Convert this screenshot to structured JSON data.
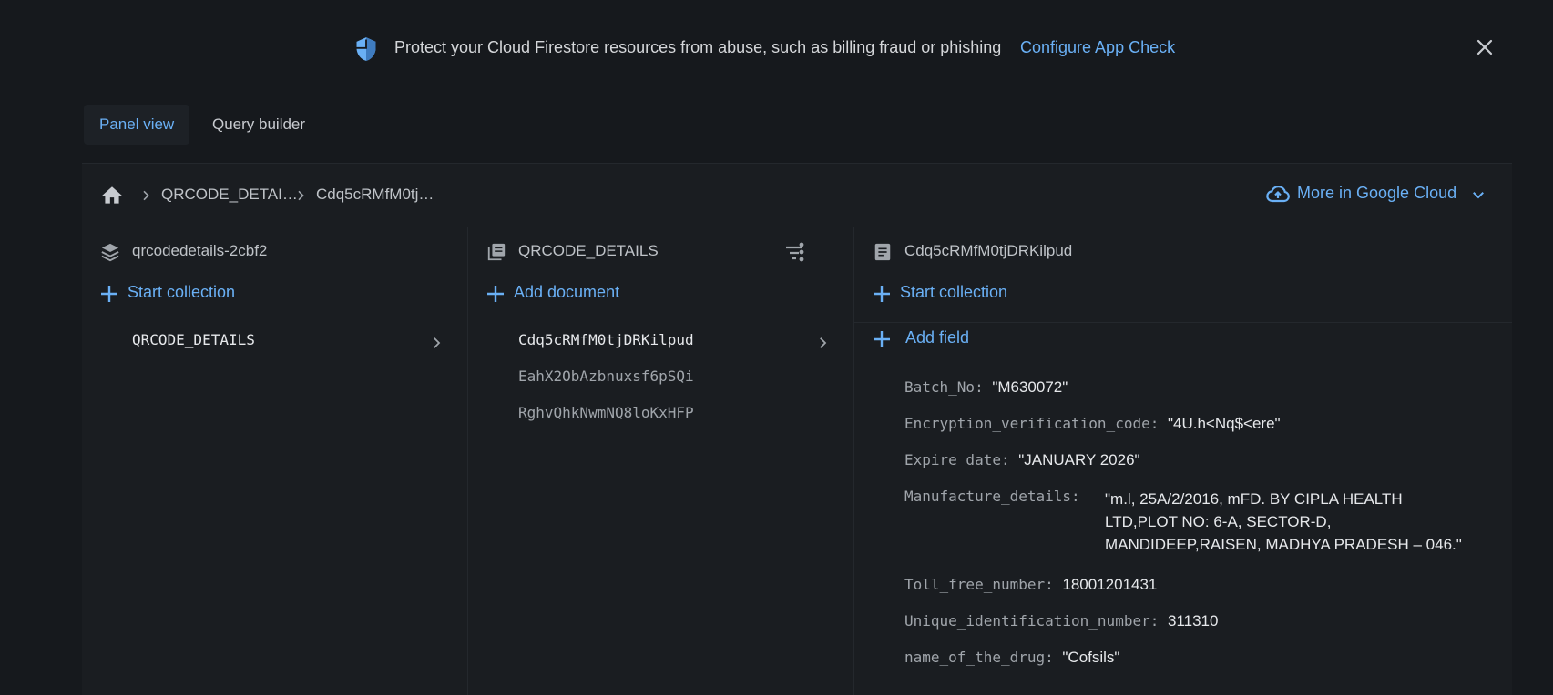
{
  "banner": {
    "icon": "shield-icon",
    "message": "Protect your Cloud Firestore resources from abuse, such as billing fraud or phishing",
    "link": "Configure App Check",
    "close_icon": "close-icon"
  },
  "tabs": [
    {
      "label": "Panel view",
      "active": true
    },
    {
      "label": "Query builder",
      "active": false
    }
  ],
  "breadcrumb": {
    "home_icon": "home-icon",
    "items": [
      "QRCODE_DETAI…",
      "Cdq5cRMfM0tj…"
    ],
    "more_label": "More in Google Cloud"
  },
  "columns": {
    "root": {
      "title": "qrcodedetails-2cbf2",
      "action": "Start collection",
      "items": [
        {
          "label": "QRCODE_DETAILS",
          "selected": true
        }
      ]
    },
    "collection": {
      "title": "QRCODE_DETAILS",
      "action": "Add document",
      "items": [
        {
          "label": "Cdq5cRMfM0tjDRKilpud",
          "selected": true
        },
        {
          "label": "EahX2ObAzbnuxsf6pSQi",
          "selected": false
        },
        {
          "label": "RghvQhkNwmNQ8loKxHFP",
          "selected": false
        }
      ]
    },
    "document": {
      "title": "Cdq5cRMfM0tjDRKilpud",
      "action": "Start collection",
      "add_field": "Add field",
      "fields": [
        {
          "key": "Batch_No:",
          "value": "\"M630072\""
        },
        {
          "key": "Encryption_verification_code:",
          "value": "\"4U.h<Nq$<ere\""
        },
        {
          "key": "Expire_date:",
          "value": "\"JANUARY 2026\""
        },
        {
          "key": "Manufacture_details:",
          "value": "\"m.l, 25A/2/2016, mFD. BY CIPLA HEALTH LTD,PLOT NO: 6-A, SECTOR-D, MANDIDEEP,RAISEN, MADHYA PRADESH – 046.\""
        },
        {
          "key": "Toll_free_number:",
          "value": "18001201431"
        },
        {
          "key": "Unique_identification_number:",
          "value": "311310"
        },
        {
          "key": "name_of_the_drug:",
          "value": "\"Cofsils\""
        }
      ]
    }
  },
  "colors": {
    "accent": "#6ab0f5",
    "background": "#16191d",
    "panel": "#1a1d21"
  }
}
